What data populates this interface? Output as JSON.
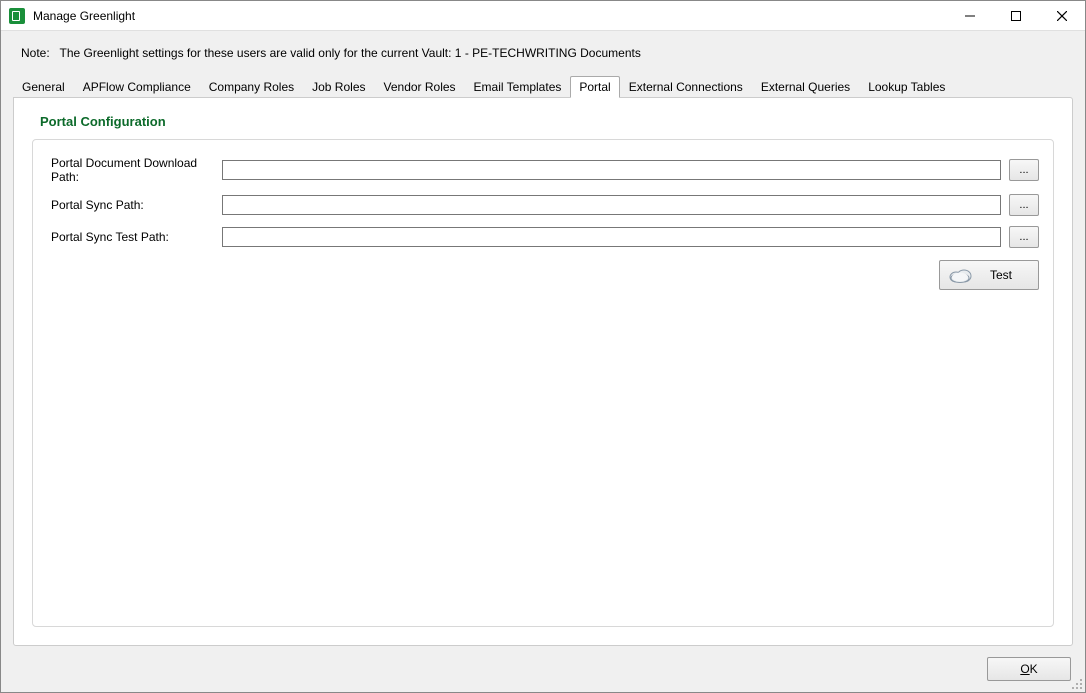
{
  "window": {
    "title": "Manage Greenlight"
  },
  "note": {
    "label": "Note:",
    "text": "The Greenlight settings for these users are valid only for the current Vault: 1 - PE-TECHWRITING Documents"
  },
  "tabs": [
    {
      "label": "General"
    },
    {
      "label": "APFlow Compliance"
    },
    {
      "label": "Company Roles"
    },
    {
      "label": "Job Roles"
    },
    {
      "label": "Vendor Roles"
    },
    {
      "label": "Email Templates"
    },
    {
      "label": "Portal"
    },
    {
      "label": "External Connections"
    },
    {
      "label": "External Queries"
    },
    {
      "label": "Lookup Tables"
    }
  ],
  "activeTabIndex": 6,
  "portal": {
    "sectionTitle": "Portal Configuration",
    "fields": {
      "downloadPath": {
        "label": "Portal Document Download Path:",
        "value": ""
      },
      "syncPath": {
        "label": "Portal Sync Path:",
        "value": ""
      },
      "syncTestPath": {
        "label": "Portal Sync Test Path:",
        "value": ""
      }
    },
    "browseLabel": "...",
    "testLabel": "Test"
  },
  "footer": {
    "okLabel": "OK"
  }
}
